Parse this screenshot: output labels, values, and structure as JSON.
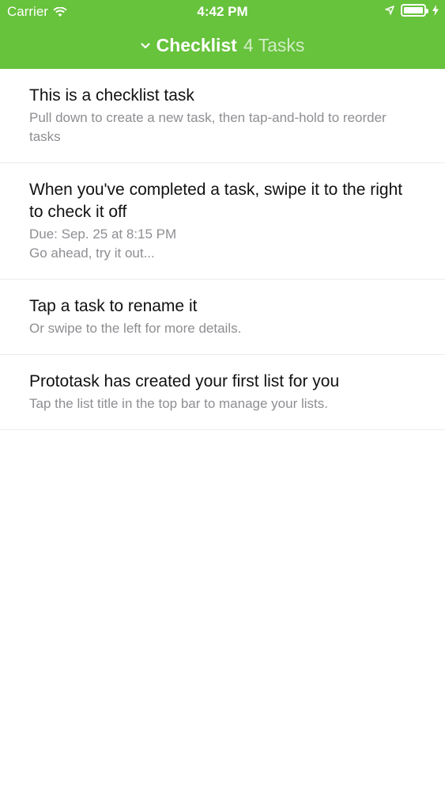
{
  "status_bar": {
    "carrier": "Carrier",
    "time": "4:42 PM"
  },
  "header": {
    "list_name": "Checklist",
    "task_count": "4 Tasks",
    "background": "#67c23c"
  },
  "tasks": [
    {
      "title": "This is a checklist task",
      "lines": [
        "Pull down to create a new task, then tap-and-hold to reorder tasks"
      ]
    },
    {
      "title": "When you've completed a task, swipe it to the right to check it off",
      "lines": [
        "Due: Sep. 25 at 8:15 PM",
        "Go ahead, try it out..."
      ]
    },
    {
      "title": "Tap a task to rename it",
      "lines": [
        "Or swipe to the left for more details."
      ]
    },
    {
      "title": "Prototask has created your first list for you",
      "lines": [
        "Tap the list title in the top bar to manage your lists."
      ]
    }
  ]
}
